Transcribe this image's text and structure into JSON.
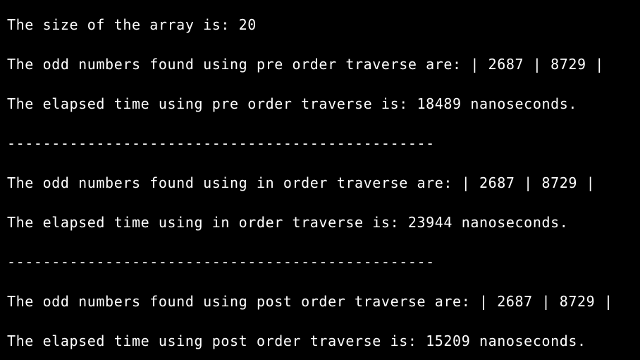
{
  "terminal": {
    "background": "#000000",
    "foreground": "#ffffff",
    "lines": [
      "The size of the array is: 20",
      "The odd numbers found using pre order traverse are: | 2687 | 8729 |",
      "The elapsed time using pre order traverse is: 18489 nanoseconds.",
      "------------------------------------------------",
      "The odd numbers found using in order traverse are: | 2687 | 8729 |",
      "The elapsed time using in order traverse is: 23944 nanoseconds.",
      "------------------------------------------------",
      "The odd numbers found using post order traverse are: | 2687 | 8729 |",
      "The elapsed time using post order traverse is: 15209 nanoseconds."
    ]
  }
}
